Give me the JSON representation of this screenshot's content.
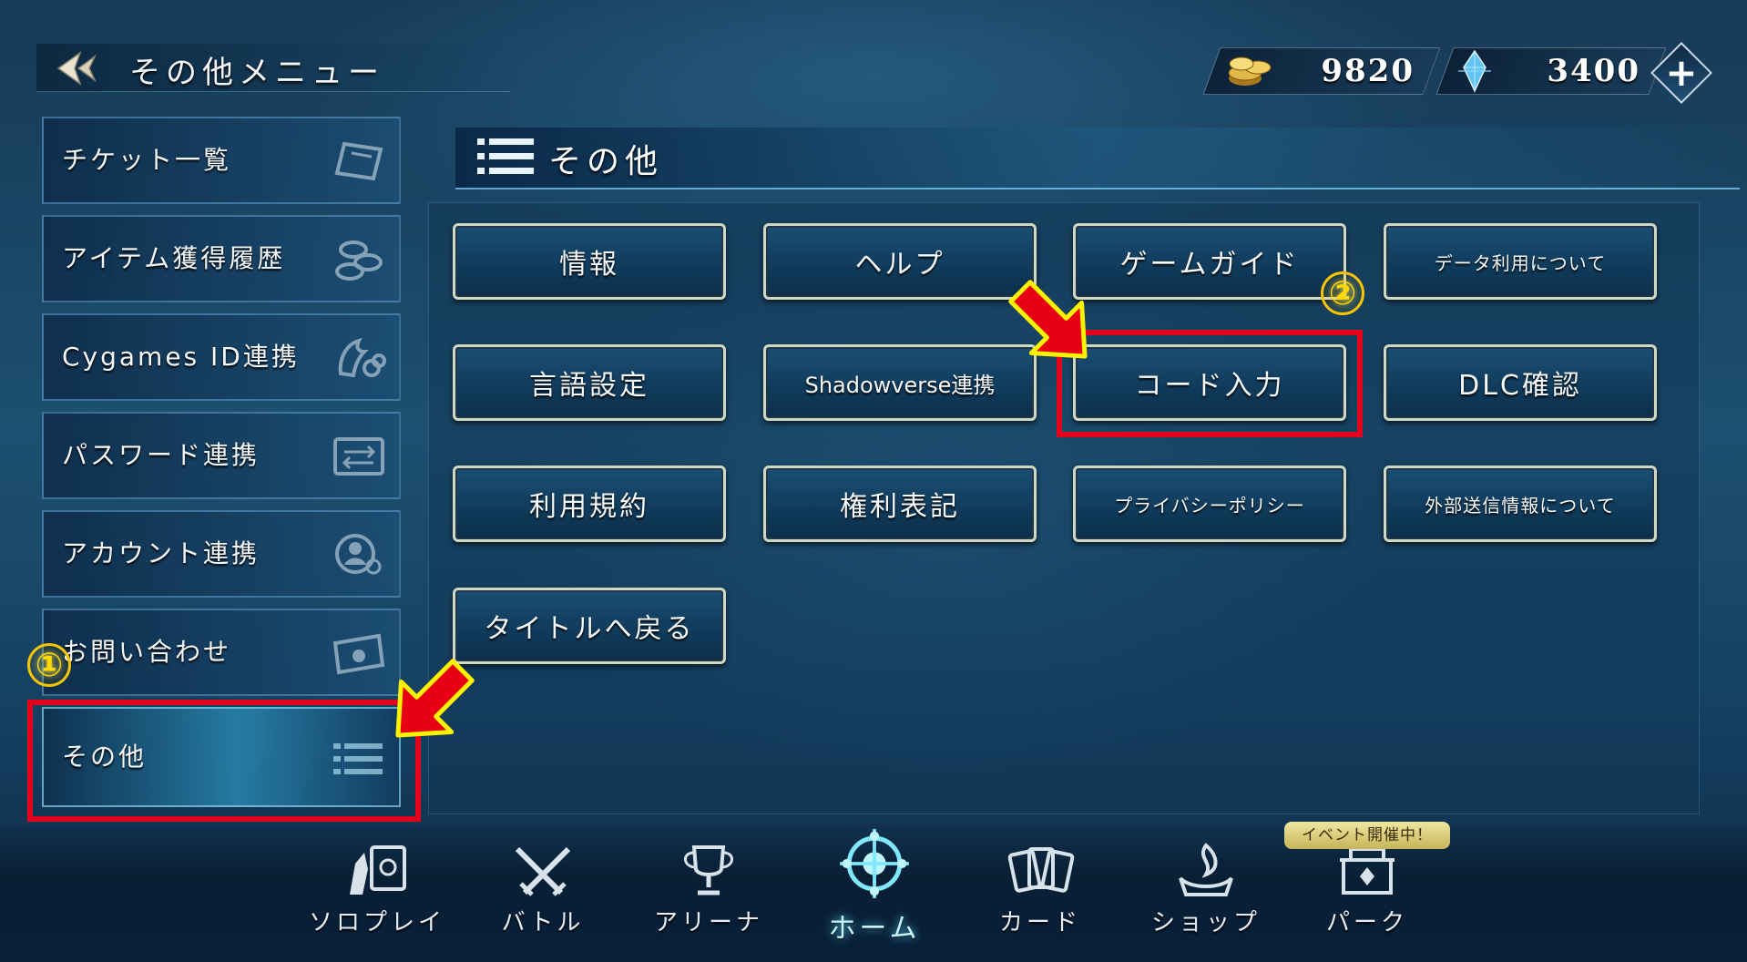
{
  "header": {
    "title": "その他メニュー",
    "gold_amount": "9820",
    "crystal_amount": "3400",
    "add_currency_label": "+"
  },
  "sidebar": {
    "items": [
      {
        "label": "チケット一覧",
        "icon": "ticket-icon"
      },
      {
        "label": "アイテム獲得履歴",
        "icon": "coins-icon"
      },
      {
        "label": "Cygames ID連携",
        "icon": "cygames-link-icon"
      },
      {
        "label": "パスワード連携",
        "icon": "password-transfer-icon"
      },
      {
        "label": "アカウント連携",
        "icon": "account-link-icon"
      },
      {
        "label": "お問い合わせ",
        "icon": "envelope-icon"
      },
      {
        "label": "その他",
        "icon": "list-icon",
        "active": true
      }
    ]
  },
  "section": {
    "title": "その他"
  },
  "buttons": {
    "info": "情報",
    "help": "ヘルプ",
    "game_guide": "ゲームガイド",
    "data_usage": "データ利用について",
    "language": "言語設定",
    "shadowverse": "Shadowverse連携",
    "code_input": "コード入力",
    "dlc": "DLC確認",
    "terms": "利用規約",
    "rights": "権利表記",
    "privacy": "プライバシーポリシー",
    "external": "外部送信情報について",
    "back_title": "タイトルへ戻る"
  },
  "annotations": {
    "step1": "①",
    "step2": "②",
    "highlight_color": "#e3001b",
    "arrow_color": "#e60012",
    "arrow_glow": "#fff200"
  },
  "bottom_nav": {
    "items": [
      {
        "label": "ソロプレイ",
        "icon": "solo-play-icon"
      },
      {
        "label": "バトル",
        "icon": "crossed-swords-icon"
      },
      {
        "label": "アリーナ",
        "icon": "trophy-icon"
      },
      {
        "label": "ホーム",
        "icon": "home-emblem-icon",
        "active": true
      },
      {
        "label": "カード",
        "icon": "cards-icon"
      },
      {
        "label": "ショップ",
        "icon": "shop-icon"
      },
      {
        "label": "パーク",
        "icon": "park-icon"
      }
    ],
    "event_badge": "イベント開催中！"
  }
}
